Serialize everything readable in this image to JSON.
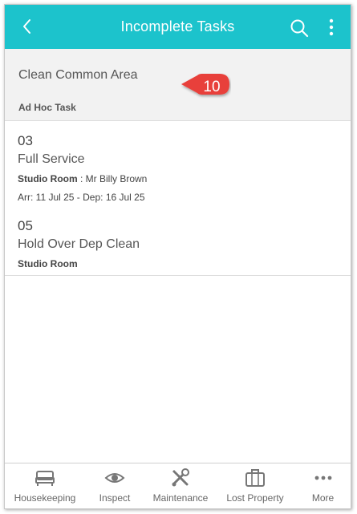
{
  "header": {
    "title": "Incomplete Tasks",
    "back_icon": "chevron-left-icon",
    "search_icon": "search-icon",
    "menu_icon": "more-vertical-icon",
    "bg_color": "#1cc3cc"
  },
  "group": {
    "name": "Clean Common Area",
    "type": "Ad Hoc Task"
  },
  "callout": {
    "number": "10",
    "color": "#e8413a"
  },
  "tasks": [
    {
      "room_number": "03",
      "service": "Full Service",
      "room_type": "Studio Room",
      "guest": " : Mr Billy Brown",
      "dates": "Arr: 11 Jul 25 - Dep: 16 Jul 25"
    },
    {
      "room_number": "05",
      "service": "Hold Over Dep Clean",
      "room_type": "Studio Room"
    }
  ],
  "tabbar": {
    "items": [
      {
        "label": "Housekeeping",
        "icon": "bed-icon"
      },
      {
        "label": "Inspect",
        "icon": "eye-icon"
      },
      {
        "label": "Maintenance",
        "icon": "tools-icon"
      },
      {
        "label": "Lost Property",
        "icon": "briefcase-icon"
      },
      {
        "label": "More",
        "icon": "more-horizontal-icon"
      }
    ]
  }
}
